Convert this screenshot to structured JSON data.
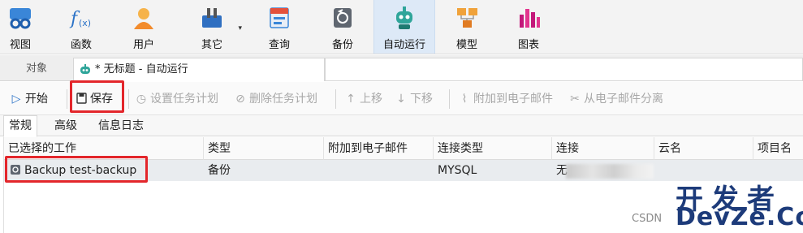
{
  "ribbon": {
    "items": [
      {
        "label": "视图",
        "icon": "view-icon"
      },
      {
        "label": "函数",
        "icon": "function-icon"
      },
      {
        "label": "用户",
        "icon": "user-icon"
      },
      {
        "label": "其它",
        "icon": "tools-icon"
      },
      {
        "label": "查询",
        "icon": "query-icon"
      },
      {
        "label": "备份",
        "icon": "backup-icon"
      },
      {
        "label": "自动运行",
        "icon": "robot-icon"
      },
      {
        "label": "模型",
        "icon": "model-icon"
      },
      {
        "label": "图表",
        "icon": "chart-icon"
      }
    ],
    "active": "自动运行",
    "dropdown_glyph": "▾"
  },
  "tabs": {
    "objects": "对象",
    "document": "* 无标题 - 自动运行"
  },
  "toolbar": {
    "start": "开始",
    "save": "保存",
    "set_schedule": "设置任务计划",
    "delete_schedule": "删除任务计划",
    "move_up": "上移",
    "move_down": "下移",
    "attach_email": "附加到电子邮件",
    "detach_email": "从电子邮件分离"
  },
  "subtabs": [
    "常规",
    "高级",
    "信息日志"
  ],
  "grid": {
    "headers": [
      "已选择的工作",
      "类型",
      "附加到电子邮件",
      "连接类型",
      "连接",
      "云名",
      "项目名"
    ],
    "rows": [
      {
        "job": "Backup test-backup",
        "type": "备份",
        "attach": "",
        "conn_type": "MYSQL",
        "conn": "无",
        "cloud": "",
        "project": ""
      }
    ]
  },
  "watermark": {
    "line1": "开发者",
    "line2": "DevZe.CoM",
    "source": "CSDN"
  },
  "colors": {
    "highlight": "#e3262b",
    "active_tab": "#dde9f7",
    "watermark": "#1d3b7a"
  }
}
